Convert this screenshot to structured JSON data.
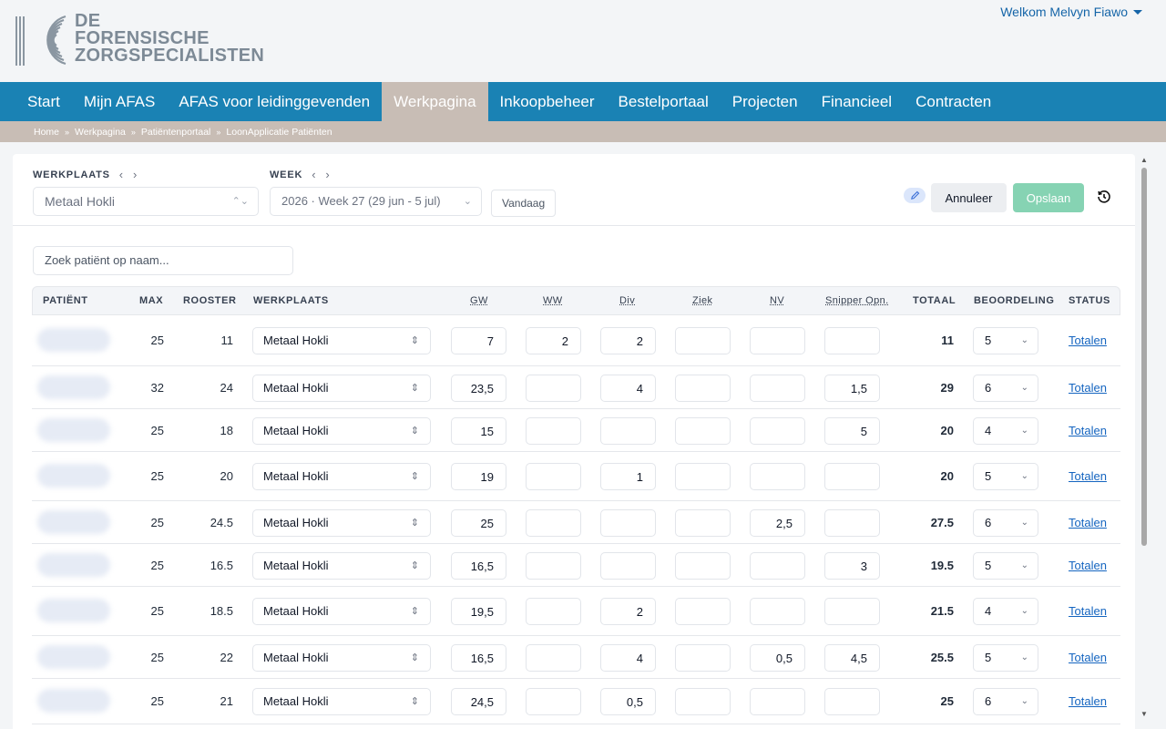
{
  "header": {
    "logo_lines": [
      "DE",
      "FORENSISCHE",
      "ZORGSPECIALISTEN"
    ],
    "welcome": "Welkom Melvyn Fiawo"
  },
  "nav": {
    "items": [
      "Start",
      "Mijn AFAS",
      "AFAS voor leidinggevenden",
      "Werkpagina",
      "Inkoopbeheer",
      "Bestelportaal",
      "Projecten",
      "Financieel",
      "Contracten"
    ],
    "active": "Werkpagina"
  },
  "breadcrumb": [
    "Home",
    "Werkpagina",
    "Patiëntenportaal",
    "LoonApplicatie Patiënten"
  ],
  "toolbar": {
    "werkplaats_label": "WERKPLAATS",
    "werkplaats_value": "Metaal Hokli",
    "week_label": "WEEK",
    "week_value": "2026 · Week 27 (29 jun - 5 jul)",
    "today_label": "Vandaag",
    "cancel_label": "Annuleer",
    "save_label": "Opslaan"
  },
  "search": {
    "placeholder": "Zoek patiënt op naam..."
  },
  "table": {
    "headers": {
      "patient": "PATIËNT",
      "max": "MAX",
      "rooster": "ROOSTER",
      "werkplaats": "WERKPLAATS",
      "gw": "GW",
      "ww": "WW",
      "div": "Div",
      "ziek": "Ziek",
      "nv": "NV",
      "snipper": "Snipper Opn.",
      "totaal": "TOTAAL",
      "beoordeling": "BEOORDELING",
      "status": "STATUS"
    },
    "rows": [
      {
        "max": "25",
        "rooster": "11",
        "werkplaats": "Metaal Hokli",
        "gw": "7",
        "ww": "2",
        "div": "2",
        "ziek": "",
        "nv": "",
        "snipper": "",
        "totaal": "11",
        "beoordeling": "5",
        "status": "Totalen"
      },
      {
        "max": "32",
        "rooster": "24",
        "werkplaats": "Metaal Hokli",
        "gw": "23,5",
        "ww": "",
        "div": "4",
        "ziek": "",
        "nv": "",
        "snipper": "1,5",
        "totaal": "29",
        "beoordeling": "6",
        "status": "Totalen"
      },
      {
        "max": "25",
        "rooster": "18",
        "werkplaats": "Metaal Hokli",
        "gw": "15",
        "ww": "",
        "div": "",
        "ziek": "",
        "nv": "",
        "snipper": "5",
        "totaal": "20",
        "beoordeling": "4",
        "status": "Totalen"
      },
      {
        "max": "25",
        "rooster": "20",
        "werkplaats": "Metaal Hokli",
        "gw": "19",
        "ww": "",
        "div": "1",
        "ziek": "",
        "nv": "",
        "snipper": "",
        "totaal": "20",
        "beoordeling": "5",
        "status": "Totalen"
      },
      {
        "max": "25",
        "rooster": "24.5",
        "werkplaats": "Metaal Hokli",
        "gw": "25",
        "ww": "",
        "div": "",
        "ziek": "",
        "nv": "2,5",
        "snipper": "",
        "totaal": "27.5",
        "beoordeling": "6",
        "status": "Totalen"
      },
      {
        "max": "25",
        "rooster": "16.5",
        "werkplaats": "Metaal Hokli",
        "gw": "16,5",
        "ww": "",
        "div": "",
        "ziek": "",
        "nv": "",
        "snipper": "3",
        "totaal": "19.5",
        "beoordeling": "5",
        "status": "Totalen"
      },
      {
        "max": "25",
        "rooster": "18.5",
        "werkplaats": "Metaal Hokli",
        "gw": "19,5",
        "ww": "",
        "div": "2",
        "ziek": "",
        "nv": "",
        "snipper": "",
        "totaal": "21.5",
        "beoordeling": "4",
        "status": "Totalen"
      },
      {
        "max": "25",
        "rooster": "22",
        "werkplaats": "Metaal Hokli",
        "gw": "16,5",
        "ww": "",
        "div": "4",
        "ziek": "",
        "nv": "0,5",
        "snipper": "4,5",
        "totaal": "25.5",
        "beoordeling": "5",
        "status": "Totalen"
      },
      {
        "max": "25",
        "rooster": "21",
        "werkplaats": "Metaal Hokli",
        "gw": "24,5",
        "ww": "",
        "div": "0,5",
        "ziek": "",
        "nv": "",
        "snipper": "",
        "totaal": "25",
        "beoordeling": "6",
        "status": "Totalen"
      }
    ]
  },
  "colors": {
    "nav_bg": "#1a82b4",
    "breadcrumb_bg": "#c8bdb5",
    "link": "#1565c0",
    "save_bg": "#86d3b3",
    "logo": "#7d8a96"
  }
}
